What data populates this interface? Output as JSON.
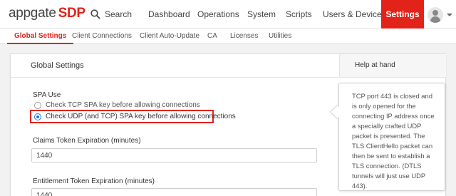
{
  "brand": {
    "name": "appgate",
    "suffix": "SDP"
  },
  "nav": {
    "search_label": "Search",
    "items": [
      "Dashboard",
      "Operations",
      "System",
      "Scripts",
      "Users & Devices",
      "Settings"
    ],
    "active": "Settings"
  },
  "subnav": {
    "items": [
      "Global Settings",
      "Client Connections",
      "Client Auto-Update",
      "CA",
      "Licenses",
      "Utilities"
    ],
    "active": "Global Settings"
  },
  "panel": {
    "title": "Global Settings",
    "help_title": "Help at hand",
    "spa_use": {
      "label": "SPA Use",
      "options": [
        "Check TCP SPA key before allowing connections",
        "Check UDP (and TCP) SPA key before allowing connections"
      ],
      "selected_index": 1
    },
    "claims_token": {
      "label": "Claims Token Expiration (minutes)",
      "value": "1440"
    },
    "entitlement_token": {
      "label": "Entitlement Token Expiration (minutes)",
      "value": "1440"
    },
    "help_text": "TCP port 443 is closed and is only opened for the connecting IP address once a specially crafted UDP packet is presented. The TLS ClientHello packet can then be sent to establish a TLS connection. (DTLS tunnels will just use UDP 443)."
  },
  "colors": {
    "accent": "#e2231a",
    "radio_selected": "#1a73e8"
  }
}
